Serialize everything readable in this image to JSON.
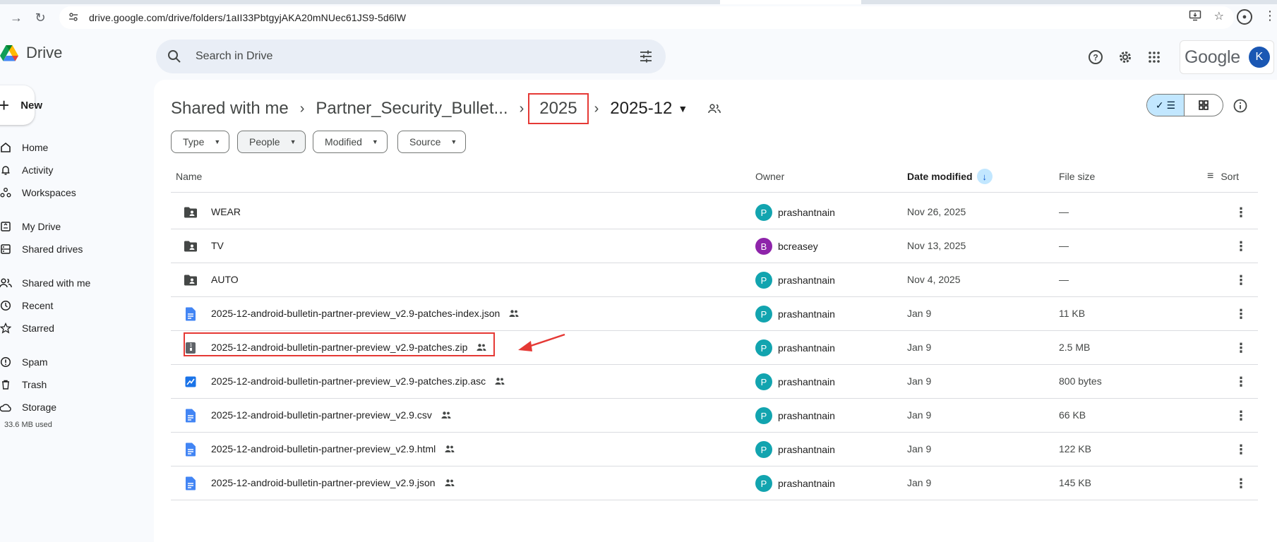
{
  "browser": {
    "url": "drive.google.com/drive/folders/1aII33PbtgyjAKA20mNUec61JS9-5d6lW",
    "icons": [
      "forward-arrow-icon",
      "reload-icon",
      "site-settings-icon",
      "install-app-icon",
      "bookmark-star-icon",
      "profile-icon",
      "more-icon"
    ]
  },
  "header": {
    "app_name": "Drive",
    "search_placeholder": "Search in Drive",
    "brand": "Google",
    "avatar_letter": "K",
    "colors": {
      "avatar": "#1a57b3",
      "search_bg": "#e9eef6"
    }
  },
  "sidebar": {
    "new_label": "New",
    "items": [
      {
        "label": "Home",
        "icon": "home-icon"
      },
      {
        "label": "Activity",
        "icon": "bell-icon"
      },
      {
        "label": "Workspaces",
        "icon": "workspaces-icon"
      },
      {
        "label": "My Drive",
        "icon": "my-drive-icon"
      },
      {
        "label": "Shared drives",
        "icon": "shared-drives-icon"
      },
      {
        "label": "Shared with me",
        "icon": "people-icon"
      },
      {
        "label": "Recent",
        "icon": "clock-icon"
      },
      {
        "label": "Starred",
        "icon": "star-icon"
      },
      {
        "label": "Spam",
        "icon": "spam-icon"
      },
      {
        "label": "Trash",
        "icon": "trash-icon"
      },
      {
        "label": "Storage",
        "icon": "cloud-icon"
      }
    ],
    "storage_used": "33.6 MB used"
  },
  "breadcrumb": {
    "items": [
      "Shared with me",
      "Partner_Security_Bullet...",
      "2025"
    ],
    "current": "2025-12",
    "highlight_color": "#e53935"
  },
  "filters": [
    "Type",
    "People",
    "Modified",
    "Source"
  ],
  "table": {
    "columns": {
      "name": "Name",
      "owner": "Owner",
      "date": "Date modified",
      "size": "File size",
      "sort": "Sort"
    },
    "rows": [
      {
        "name": "WEAR",
        "type": "shared-folder",
        "shared": false,
        "owner": "prashantnain",
        "owner_initial": "P",
        "owner_color": "#12a4af",
        "date": "Nov 26, 2025",
        "size": "—"
      },
      {
        "name": "TV",
        "type": "shared-folder",
        "shared": false,
        "owner": "bcreasey",
        "owner_initial": "B",
        "owner_color": "#8e24aa",
        "date": "Nov 13, 2025",
        "size": "—"
      },
      {
        "name": "AUTO",
        "type": "shared-folder",
        "shared": false,
        "owner": "prashantnain",
        "owner_initial": "P",
        "owner_color": "#12a4af",
        "date": "Nov 4, 2025",
        "size": "—"
      },
      {
        "name": "2025-12-android-bulletin-partner-preview_v2.9-patches-index.json",
        "type": "doc",
        "shared": true,
        "owner": "prashantnain",
        "owner_initial": "P",
        "owner_color": "#12a4af",
        "date": "Jan 9",
        "size": "11 KB"
      },
      {
        "name": "2025-12-android-bulletin-partner-preview_v2.9-patches.zip",
        "type": "zip",
        "shared": true,
        "owner": "prashantnain",
        "owner_initial": "P",
        "owner_color": "#12a4af",
        "date": "Jan 9",
        "size": "2.5 MB"
      },
      {
        "name": "2025-12-android-bulletin-partner-preview_v2.9-patches.zip.asc",
        "type": "image",
        "shared": true,
        "owner": "prashantnain",
        "owner_initial": "P",
        "owner_color": "#12a4af",
        "date": "Jan 9",
        "size": "800 bytes"
      },
      {
        "name": "2025-12-android-bulletin-partner-preview_v2.9.csv",
        "type": "doc",
        "shared": true,
        "owner": "prashantnain",
        "owner_initial": "P",
        "owner_color": "#12a4af",
        "date": "Jan 9",
        "size": "66 KB"
      },
      {
        "name": "2025-12-android-bulletin-partner-preview_v2.9.html",
        "type": "doc",
        "shared": true,
        "owner": "prashantnain",
        "owner_initial": "P",
        "owner_color": "#12a4af",
        "date": "Jan 9",
        "size": "122 KB"
      },
      {
        "name": "2025-12-android-bulletin-partner-preview_v2.9.json",
        "type": "doc",
        "shared": true,
        "owner": "prashantnain",
        "owner_initial": "P",
        "owner_color": "#12a4af",
        "date": "Jan 9",
        "size": "145 KB"
      }
    ]
  },
  "annotations": {
    "highlighted_row": 4,
    "arrow_color": "#e53935"
  }
}
